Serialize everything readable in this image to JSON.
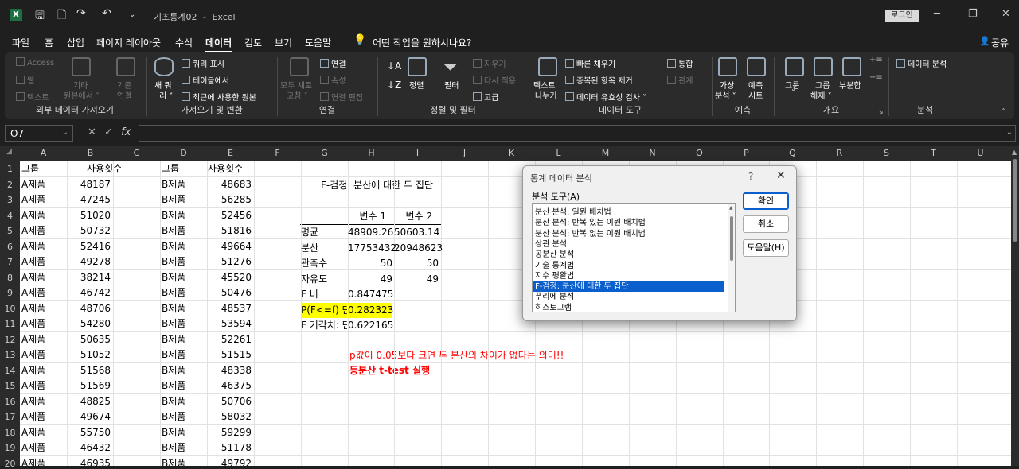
{
  "titlebar": {
    "app_icon": "X",
    "title": "기초통계02",
    "app": "Excel",
    "separator": "-",
    "login": "로그인"
  },
  "menu": {
    "items": [
      "파일",
      "홈",
      "삽입",
      "페이지 레이아웃",
      "수식",
      "데이터",
      "검토",
      "보기",
      "도움말"
    ],
    "search": "어떤 작업을 원하시나요?",
    "share": "공유"
  },
  "ribbon": {
    "g1": {
      "label": "외부 데이터 가져오기",
      "access": "Access",
      "web": "웹",
      "text": "텍스트",
      "other1": "기타",
      "other2": "원본에서 ˅",
      "exist1": "기존",
      "exist2": "연결"
    },
    "g2": {
      "label": "가져오기 및 변환",
      "new1": "새 쿼",
      "new2": "리 ˅",
      "q1": "쿼리 표시",
      "q2": "테이블에서",
      "q3": "최근에 사용한 원본"
    },
    "g3": {
      "label": "연결",
      "refresh1": "모두 새로",
      "refresh2": "고침 ˅",
      "c1": "연결",
      "c2": "속성",
      "c3": "연결 편집"
    },
    "g4": {
      "label": "정렬 및 필터",
      "sort": "정렬",
      "filter": "필터",
      "f1": "지우기",
      "f2": "다시 적용",
      "f3": "고급"
    },
    "g5": {
      "label": "데이터 도구",
      "t1": "텍스트",
      "t2": "나누기",
      "d1": "빠른 채우기",
      "d2": "중복된 항목 제거",
      "d3": "데이터 유효성 검사",
      "d4": "통합",
      "d5": "관계"
    },
    "g6": {
      "label": "예측",
      "w1": "가상",
      "w2": "분석 ˅",
      "p1": "예측",
      "p2": "시트"
    },
    "g7": {
      "label": "개요",
      "gr1": "그룹",
      "gr2": "˅",
      "ug1": "그룹",
      "ug2": "해제 ˅",
      "sub": "부분합"
    },
    "g8": {
      "label": "분석",
      "da": "데이터 분석"
    }
  },
  "formula_bar": {
    "namebox": "O7",
    "fx": "fx",
    "value": ""
  },
  "columns": [
    "A",
    "B",
    "C",
    "D",
    "E",
    "F",
    "G",
    "H",
    "I",
    "J",
    "K",
    "L",
    "M",
    "N",
    "O",
    "P",
    "Q",
    "R",
    "S",
    "T",
    "U"
  ],
  "rows": [
    "1",
    "2",
    "3",
    "4",
    "5",
    "6",
    "7",
    "8",
    "9",
    "10",
    "11",
    "12",
    "13",
    "14",
    "15",
    "16",
    "17",
    "18",
    "19",
    "20"
  ],
  "sheet": {
    "hA": "그룹",
    "hB": "사용횟수",
    "hD": "그룹",
    "hE": "사용횟수",
    "colA": [
      "A제품",
      "A제품",
      "A제품",
      "A제품",
      "A제품",
      "A제품",
      "A제품",
      "A제품",
      "A제품",
      "A제품",
      "A제품",
      "A제품",
      "A제품",
      "A제품",
      "A제품",
      "A제품",
      "A제품",
      "A제품",
      "A제품"
    ],
    "colB": [
      "48187",
      "47245",
      "51020",
      "50732",
      "52416",
      "49278",
      "38214",
      "46742",
      "48706",
      "54280",
      "50635",
      "51052",
      "51568",
      "51569",
      "48825",
      "49674",
      "55750",
      "46432",
      "46935"
    ],
    "colD": [
      "B제품",
      "B제품",
      "B제품",
      "B제품",
      "B제품",
      "B제품",
      "B제품",
      "B제품",
      "B제품",
      "B제품",
      "B제품",
      "B제품",
      "B제품",
      "B제품",
      "B제품",
      "B제품",
      "B제품",
      "B제품",
      "B제품"
    ],
    "colE": [
      "48683",
      "56285",
      "52456",
      "51816",
      "49664",
      "51276",
      "45520",
      "50476",
      "48537",
      "53594",
      "52261",
      "51515",
      "48338",
      "46375",
      "50706",
      "58032",
      "59299",
      "51178",
      "49792"
    ],
    "ftest": {
      "title": "F-검정: 분산에 대한 두 집단",
      "h1": "변수 1",
      "h2": "변수 2",
      "rows": [
        {
          "label": "평균",
          "v1": "48909.26",
          "v2": "50603.14"
        },
        {
          "label": "분산",
          "v1": "17753432",
          "v2": "20948623"
        },
        {
          "label": "관측수",
          "v1": "50",
          "v2": "50"
        },
        {
          "label": "자유도",
          "v1": "49",
          "v2": "49"
        },
        {
          "label": "F 비",
          "v1": "0.847475",
          "v2": ""
        },
        {
          "label": "P(F<=f) 단",
          "v1": "0.282323",
          "v2": ""
        },
        {
          "label": "F 기각치: 단",
          "v1": "0.622165",
          "v2": ""
        }
      ]
    },
    "note1": "p값이 0.05보다 크면 두 분산의 차이가 없다는 의미!!",
    "note2": "등분산 t-test 실행"
  },
  "dialog": {
    "title": "통계 데이터 분석",
    "help": "?",
    "close": "✕",
    "label": "분석 도구(A)",
    "items": [
      "분산 분석: 일원 배치법",
      "분산 분석: 반복 있는 이원 배치법",
      "분산 분석: 반복 없는 이원 배치법",
      "상관 분석",
      "공분산 분석",
      "기술 통계법",
      "지수 평활법",
      "F-검정: 분산에 대한 두 집단",
      "푸리에 분석",
      "히스토그램"
    ],
    "selected_index": 7,
    "ok": "확인",
    "cancel": "취소",
    "helpbtn": "도움말(H)"
  },
  "colors": {
    "highlight": "#ffff00",
    "note": "#ff0000",
    "accent": "#0a5fcc"
  }
}
